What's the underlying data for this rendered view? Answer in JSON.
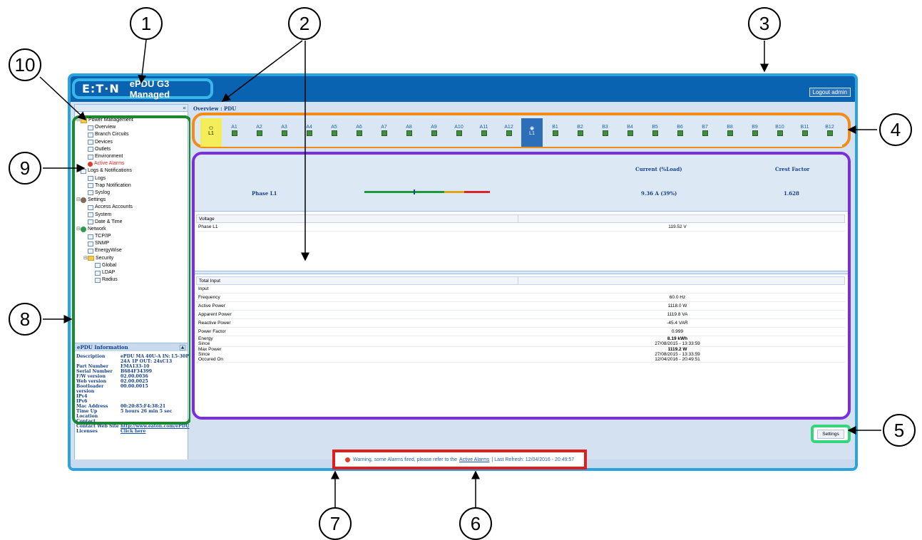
{
  "header": {
    "logo": "E:T·N",
    "product": "ePDU G3 Managed",
    "logout_label": "Logout admin"
  },
  "left": {
    "collapse_label": "«",
    "tree": [
      {
        "label": "Power Management",
        "level": 0,
        "icon": "folder-icon",
        "expand": "⊟"
      },
      {
        "label": "Overview",
        "level": 1,
        "icon": "page-icon"
      },
      {
        "label": "Branch Circuits",
        "level": 1,
        "icon": "page-icon"
      },
      {
        "label": "Devices",
        "level": 1,
        "icon": "page-icon"
      },
      {
        "label": "Outlets",
        "level": 1,
        "icon": "page-icon"
      },
      {
        "label": "Environment",
        "level": 1,
        "icon": "page-icon"
      },
      {
        "label": "Active Alarms",
        "level": 1,
        "icon": "alarm-icon",
        "alert": true
      },
      {
        "label": "Logs & Notifications",
        "level": 0,
        "icon": "page-icon",
        "expand": "⊟"
      },
      {
        "label": "Logs",
        "level": 1,
        "icon": "page-icon"
      },
      {
        "label": "Trap Notification",
        "level": 1,
        "icon": "page-icon"
      },
      {
        "label": "Syslog",
        "level": 1,
        "icon": "page-icon"
      },
      {
        "label": "Settings",
        "level": 0,
        "icon": "gear-icon",
        "expand": "⊟"
      },
      {
        "label": "Access Accounts",
        "level": 1,
        "icon": "page-icon"
      },
      {
        "label": "System",
        "level": 1,
        "icon": "page-icon"
      },
      {
        "label": "Date & Time",
        "level": 1,
        "icon": "page-icon"
      },
      {
        "label": "Network",
        "level": 0,
        "icon": "globe-icon",
        "expand": "⊟"
      },
      {
        "label": "TCP/IP",
        "level": 1,
        "icon": "page-icon"
      },
      {
        "label": "SNMP",
        "level": 1,
        "icon": "page-icon"
      },
      {
        "label": "EnergyWise",
        "level": 1,
        "icon": "page-icon"
      },
      {
        "label": "Security",
        "level": 1,
        "icon": "folder-icon",
        "expand": "⊟"
      },
      {
        "label": "Global",
        "level": 2,
        "icon": "page-icon"
      },
      {
        "label": "LDAP",
        "level": 2,
        "icon": "page-icon"
      },
      {
        "label": "Radius",
        "level": 2,
        "icon": "page-icon"
      }
    ],
    "info_title": "ePDU Information",
    "info": [
      {
        "k": "Description",
        "v": "ePDU MA 40U-A IN: L5-30P 24A 1P OUT: 24xC13"
      },
      {
        "k": "Part Number",
        "v": "EMA133-10"
      },
      {
        "k": "Serial Number",
        "v": "B684F34399"
      },
      {
        "k": "F/W version",
        "v": "02.00.0036"
      },
      {
        "k": "Web version",
        "v": "02.00.0025"
      },
      {
        "k": "Bootloader version",
        "v": "00.00.0015"
      },
      {
        "k": "IPv4",
        "v": ""
      },
      {
        "k": "IPv6",
        "v": ""
      },
      {
        "k": "Mac Address",
        "v": "00:20:85:F4:38:21"
      },
      {
        "k": "Time Up",
        "v": "5 hours 26 min 5 sec"
      },
      {
        "k": "Location",
        "v": ""
      },
      {
        "k": "Contact",
        "v": ""
      },
      {
        "k": "Contact Web Site",
        "v": "http://www.eaton.com/ePDU",
        "link": true
      },
      {
        "k": "Licenses",
        "v": "Click here",
        "link": true
      }
    ]
  },
  "main": {
    "breadcrumb": "Overview : PDU",
    "phase_tab": "L1",
    "outlets_a": [
      "A1",
      "A2",
      "A3",
      "A4",
      "A5",
      "A6",
      "A7",
      "A8",
      "A9",
      "A10",
      "A11",
      "A12"
    ],
    "phase_selected": "L1",
    "outlets_b": [
      "B1",
      "B2",
      "B3",
      "B4",
      "B5",
      "B6",
      "B7",
      "B8",
      "B9",
      "B10",
      "B11",
      "B12"
    ],
    "phase": {
      "col_current": "Current (%Load)",
      "col_crest": "Crest Factor",
      "label": "Phase L1",
      "current": "9.36 A (39%)",
      "crest": "1.628",
      "load_fraction": 0.39
    },
    "voltage": {
      "header": "Voltage",
      "rows": [
        {
          "label": "Phase L1",
          "value": "119.52 V"
        }
      ]
    },
    "total_input": {
      "header": "Total Input",
      "rows": [
        {
          "label": [
            "Input"
          ],
          "value": [
            ""
          ]
        },
        {
          "label": [
            "Frequency"
          ],
          "value": [
            "60.0 Hz"
          ]
        },
        {
          "label": [
            "Active Power"
          ],
          "value": [
            "1118.0 W"
          ]
        },
        {
          "label": [
            "Apparent Power"
          ],
          "value": [
            "1119.8 VA"
          ]
        },
        {
          "label": [
            "Reactive Power"
          ],
          "value": [
            "-45.4 VAR"
          ]
        },
        {
          "label": [
            "Power Factor"
          ],
          "value": [
            "0.999"
          ]
        },
        {
          "label": [
            "Energy",
            "Since"
          ],
          "value": [
            "8.19 kWh",
            "27/08/2015 - 13:33:59"
          ],
          "bold_first": true
        },
        {
          "label": [
            "Max Power",
            "Since",
            "Occured On"
          ],
          "value": [
            "1119.2 W",
            "27/08/2015 - 13:33:59",
            "12/04/2016 - 20:49:51"
          ],
          "bold_first": true
        }
      ]
    },
    "settings_label": "Settings"
  },
  "status": {
    "prefix": "Warning, some Alarms fired, please refer to the",
    "link": "Active Alarms",
    "suffix": "| Last Refresh: 12/04/2016 - 20:49:57"
  },
  "callouts": [
    "1",
    "2",
    "3",
    "4",
    "5",
    "6",
    "7",
    "8",
    "9",
    "10"
  ]
}
